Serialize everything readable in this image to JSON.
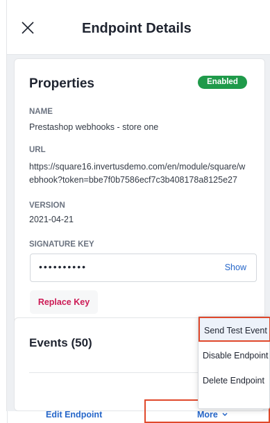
{
  "header": {
    "title": "Endpoint Details"
  },
  "properties": {
    "title": "Properties",
    "status_badge": "Enabled",
    "name_label": "NAME",
    "name_value": "Prestashop webhooks - store one",
    "url_label": "URL",
    "url_line1": "https://square16.invertusdemo.com/en/module/square/w",
    "url_line2": "ebhook?token=bbe7f0b7586ecf7c3b408178a8125e27",
    "version_label": "VERSION",
    "version_value": "2021-04-21",
    "signature_label": "SIGNATURE KEY",
    "signature_mask": "••••••••••",
    "show_label": "Show",
    "replace_label": "Replace Key"
  },
  "events": {
    "title": "Events (50)"
  },
  "footer": {
    "edit_label": "Edit Endpoint",
    "more_label": "More"
  },
  "menu": {
    "items": [
      "Send Test Event",
      "Disable Endpoint",
      "Delete Endpoint"
    ]
  },
  "colors": {
    "accent": "#2566c9",
    "success": "#1f9a4a",
    "danger": "#cc1a55",
    "highlight": "#e0482a"
  }
}
